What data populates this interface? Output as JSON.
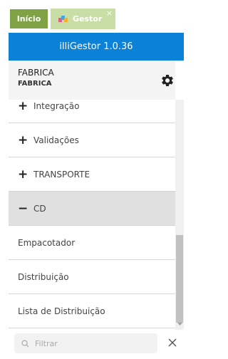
{
  "tabs": [
    {
      "label": "Início",
      "active": true
    },
    {
      "label": "Gestor",
      "closable": true
    }
  ],
  "tab_close_glyph": "×",
  "header": {
    "title": "illiGestor 1.0.36",
    "color": "#0b82d7"
  },
  "company": {
    "name": "FABRICA",
    "subtitle": "FABRICA"
  },
  "menu": {
    "items": [
      {
        "sign": "+",
        "label": "Integração"
      },
      {
        "sign": "+",
        "label": "Validações"
      },
      {
        "sign": "+",
        "label": "TRANSPORTE"
      },
      {
        "sign": "−",
        "label": "CD",
        "expanded": true
      }
    ],
    "sub_items": [
      {
        "label": "Empacotador"
      },
      {
        "label": "Distribuição"
      },
      {
        "label": "Lista de Distribuição"
      }
    ]
  },
  "filter": {
    "placeholder": "Filtrar",
    "value": ""
  },
  "colors": {
    "tab_active": "#7fa344",
    "tab_inactive": "#c9dda6",
    "accent": "#0b82d7"
  }
}
